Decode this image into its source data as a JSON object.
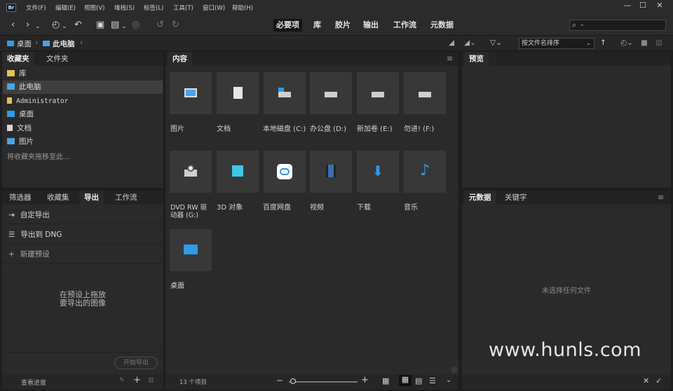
{
  "app": {
    "logo_text": "Br"
  },
  "menu": [
    "文件(F)",
    "编辑(E)",
    "视图(V)",
    "堆栈(S)",
    "标签(L)",
    "工具(T)",
    "窗口(W)",
    "帮助(H)"
  ],
  "window_controls": {
    "minimize": "—",
    "maximize": "☐",
    "close": "✕"
  },
  "workspaces": [
    "必要项",
    "库",
    "胶片",
    "输出",
    "工作流",
    "元数据"
  ],
  "toolbar": {
    "search_icon": "⌕"
  },
  "path": {
    "crumbs": [
      "桌面",
      "此电脑"
    ],
    "sort_label": "按文件名排序"
  },
  "favorites": {
    "tabs": [
      "收藏夹",
      "文件夹"
    ],
    "items": [
      {
        "label": "库",
        "icon": "library-icon",
        "color": "#e8c050"
      },
      {
        "label": "此电脑",
        "icon": "computer-icon",
        "color": "#4aa3e8"
      },
      {
        "label": "Administrator",
        "icon": "user-folder-icon",
        "color": "#e8c050"
      },
      {
        "label": "桌面",
        "icon": "desktop-icon",
        "color": "#2e9be8"
      },
      {
        "label": "文档",
        "icon": "document-icon",
        "color": "#d8d8d8"
      },
      {
        "label": "图片",
        "icon": "picture-icon",
        "color": "#4aa3e8"
      }
    ],
    "drop_hint": "将收藏夹拖移至此..."
  },
  "bottom_left": {
    "tabs": [
      "筛选器",
      "收藏集",
      "导出",
      "工作流"
    ],
    "export_items": [
      "自定导出",
      "导出到 DNG",
      "新建预设"
    ],
    "drop_hint_line1": "在预设上拖放",
    "drop_hint_line2": "要导出的图像",
    "start_export": "开始导出",
    "view_progress": "查看进度"
  },
  "content": {
    "tab": "内容",
    "items": [
      {
        "label": "图片",
        "icon": "picture-folder-icon"
      },
      {
        "label": "文档",
        "icon": "document-folder-icon"
      },
      {
        "label": "本地磁盘 (C:)",
        "icon": "system-drive-icon"
      },
      {
        "label": "办公盘 (D:)",
        "icon": "drive-icon"
      },
      {
        "label": "新加卷 (E:)",
        "icon": "drive-icon"
      },
      {
        "label": "勿进! (F:)",
        "icon": "drive-icon"
      },
      {
        "label": "DVD RW 驱动器 (G:)",
        "icon": "dvd-drive-icon"
      },
      {
        "label": "3D 对象",
        "icon": "3d-objects-icon"
      },
      {
        "label": "百度网盘",
        "icon": "baidu-netdisk-icon"
      },
      {
        "label": "视频",
        "icon": "video-icon"
      },
      {
        "label": "下载",
        "icon": "download-icon"
      },
      {
        "label": "音乐",
        "icon": "music-icon"
      },
      {
        "label": "桌面",
        "icon": "desktop-folder-icon"
      }
    ],
    "count": "13 个项目"
  },
  "preview": {
    "tab": "预览"
  },
  "metadata": {
    "tabs": [
      "元数据",
      "关键字"
    ],
    "empty": "未选择任何文件"
  },
  "watermark": "www.hunls.com"
}
